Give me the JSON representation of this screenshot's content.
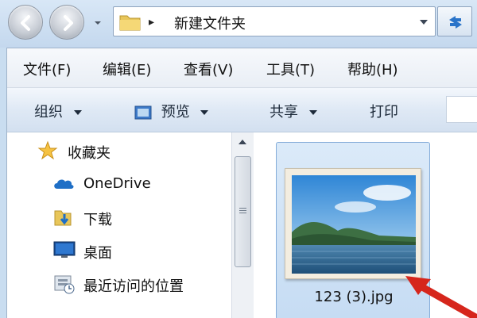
{
  "address_bar": {
    "path_separator": "▸",
    "current_folder": "新建文件夹"
  },
  "menu": [
    {
      "label": "文件(F)"
    },
    {
      "label": "编辑(E)"
    },
    {
      "label": "查看(V)"
    },
    {
      "label": "工具(T)"
    },
    {
      "label": "帮助(H)"
    }
  ],
  "toolbar": {
    "organize": "组织",
    "preview": "预览",
    "share": "共享",
    "print": "打印"
  },
  "nav_pane": {
    "items": [
      {
        "label": "收藏夹",
        "icon": "star-icon"
      },
      {
        "label": "OneDrive",
        "icon": "cloud-icon"
      },
      {
        "label": "下载",
        "icon": "download-folder-icon"
      },
      {
        "label": "桌面",
        "icon": "desktop-icon"
      },
      {
        "label": "最近访问的位置",
        "icon": "recent-places-icon"
      }
    ]
  },
  "files": [
    {
      "name": "123 (3).jpg",
      "selected": true
    }
  ],
  "colors": {
    "selection": "#c6dcf3",
    "annotation_arrow": "#d6261c"
  }
}
